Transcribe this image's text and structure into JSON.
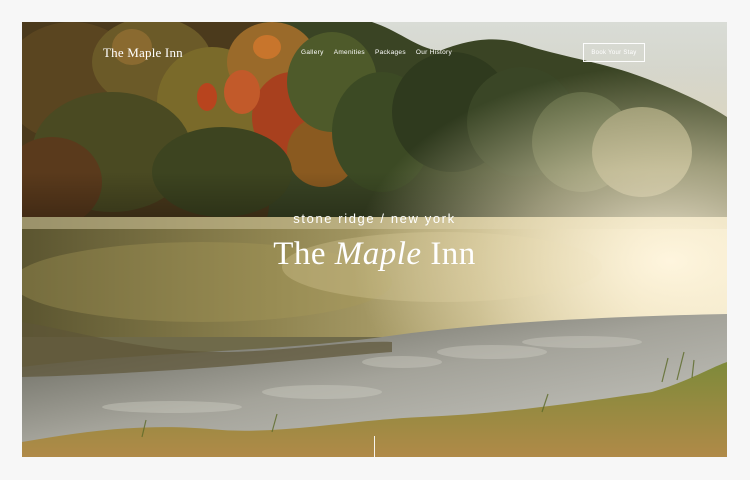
{
  "site": {
    "brand": "The Maple Inn"
  },
  "nav": {
    "items": [
      {
        "label": "Gallery"
      },
      {
        "label": "Amenities"
      },
      {
        "label": "Packages"
      },
      {
        "label": "Our History"
      }
    ],
    "cta_label": "Book Your Stay"
  },
  "hero": {
    "tagline": "stone ridge / new york",
    "title_pre": "The ",
    "title_italic": "Maple",
    "title_post": " Inn",
    "image_subject": "misty lake at sunrise with autumn forest"
  },
  "colors": {
    "page_background": "#f7f7f7",
    "text_on_image": "#ffffff",
    "fog": "#e8dcb8",
    "foliage_dark": "#2f3a1e",
    "foliage_red": "#a8401e",
    "water": "#8a8a82"
  }
}
